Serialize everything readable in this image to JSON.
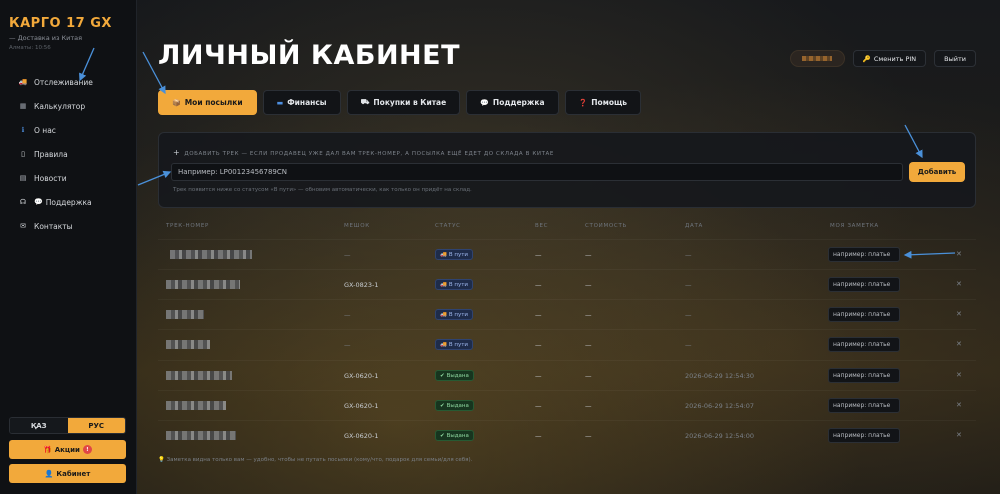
{
  "brand": {
    "title": "КАРГО 17 GX",
    "subtitle": "— Доставка из Китая",
    "city": "Алматы: 10:56"
  },
  "sidebar": {
    "items": [
      {
        "label": "Отслеживание",
        "icon": "truck-icon"
      },
      {
        "label": "Калькулятор",
        "icon": "calculator-icon"
      },
      {
        "label": "О нас",
        "icon": "info-icon"
      },
      {
        "label": "Правила",
        "icon": "document-icon"
      },
      {
        "label": "Новости",
        "icon": "newspaper-icon"
      },
      {
        "label": "Поддержка",
        "icon": "headset-icon"
      },
      {
        "label": "Контакты",
        "icon": "envelope-icon"
      }
    ],
    "lang": {
      "kz": "ҚАЗ",
      "ru": "РУС",
      "active": "ru"
    },
    "promo_label": "Акции",
    "promo_badge": "!",
    "cabinet_label": "Кабинет"
  },
  "header": {
    "title": "ЛИЧНЫЙ КАБИНЕТ",
    "change_pin": "Сменить PIN",
    "logout": "Выйти"
  },
  "tabs": [
    {
      "label": "Мои посылки",
      "icon": "box-icon",
      "active": true
    },
    {
      "label": "Финансы",
      "icon": "card-icon",
      "active": false
    },
    {
      "label": "Покупки в Китае",
      "icon": "shop-icon",
      "active": false
    },
    {
      "label": "Поддержка",
      "icon": "chat-icon",
      "active": false
    },
    {
      "label": "Помощь",
      "icon": "question-icon",
      "active": false
    }
  ],
  "add_track": {
    "hint": "ДОБАВИТЬ ТРЕК — ЕСЛИ ПРОДАВЕЦ УЖЕ ДАЛ ВАМ ТРЕК-НОМЕР, А ПОСЫЛКА ЕЩЁ ЕДЕТ ДО СКЛАДА В КИТАЕ",
    "placeholder": "Например: LP00123456789CN",
    "value": "",
    "button": "Добавить",
    "note": "Трек появится ниже со статусом «В пути» — обновим автоматически, как только он придёт на склад."
  },
  "table": {
    "columns": [
      "ТРЕК-НОМЕР",
      "МЕШОК",
      "СТАТУС",
      "ВЕС",
      "СТОИМОСТЬ",
      "ДАТА",
      "МОЯ ЗАМЕТКА"
    ],
    "note_placeholder": "например: платье",
    "rows": [
      {
        "bag": "—",
        "status": "В пути",
        "status_kind": "transit",
        "weight": "—",
        "cost": "—",
        "date": "—"
      },
      {
        "bag": "GX-0823-1",
        "status": "В пути",
        "status_kind": "transit",
        "weight": "—",
        "cost": "—",
        "date": "—"
      },
      {
        "bag": "—",
        "status": "В пути",
        "status_kind": "transit",
        "weight": "—",
        "cost": "—",
        "date": "—"
      },
      {
        "bag": "—",
        "status": "В пути",
        "status_kind": "transit",
        "weight": "—",
        "cost": "—",
        "date": "—"
      },
      {
        "bag": "GX-0620-1",
        "status": "Выдана",
        "status_kind": "issued",
        "weight": "—",
        "cost": "—",
        "date": "2026-06-29 12:54:30"
      },
      {
        "bag": "GX-0620-1",
        "status": "Выдана",
        "status_kind": "issued",
        "weight": "—",
        "cost": "—",
        "date": "2026-06-29 12:54:07"
      },
      {
        "bag": "GX-0620-1",
        "status": "Выдана",
        "status_kind": "issued",
        "weight": "—",
        "cost": "—",
        "date": "2026-06-29 12:54:00"
      }
    ]
  },
  "footer_note": "Заметка видна только вам — удобно, чтобы не путать посылки (кому/что, подарок для семьи/для себя).",
  "colors": {
    "accent": "#f2a93b",
    "arrow": "#4a90d9"
  }
}
